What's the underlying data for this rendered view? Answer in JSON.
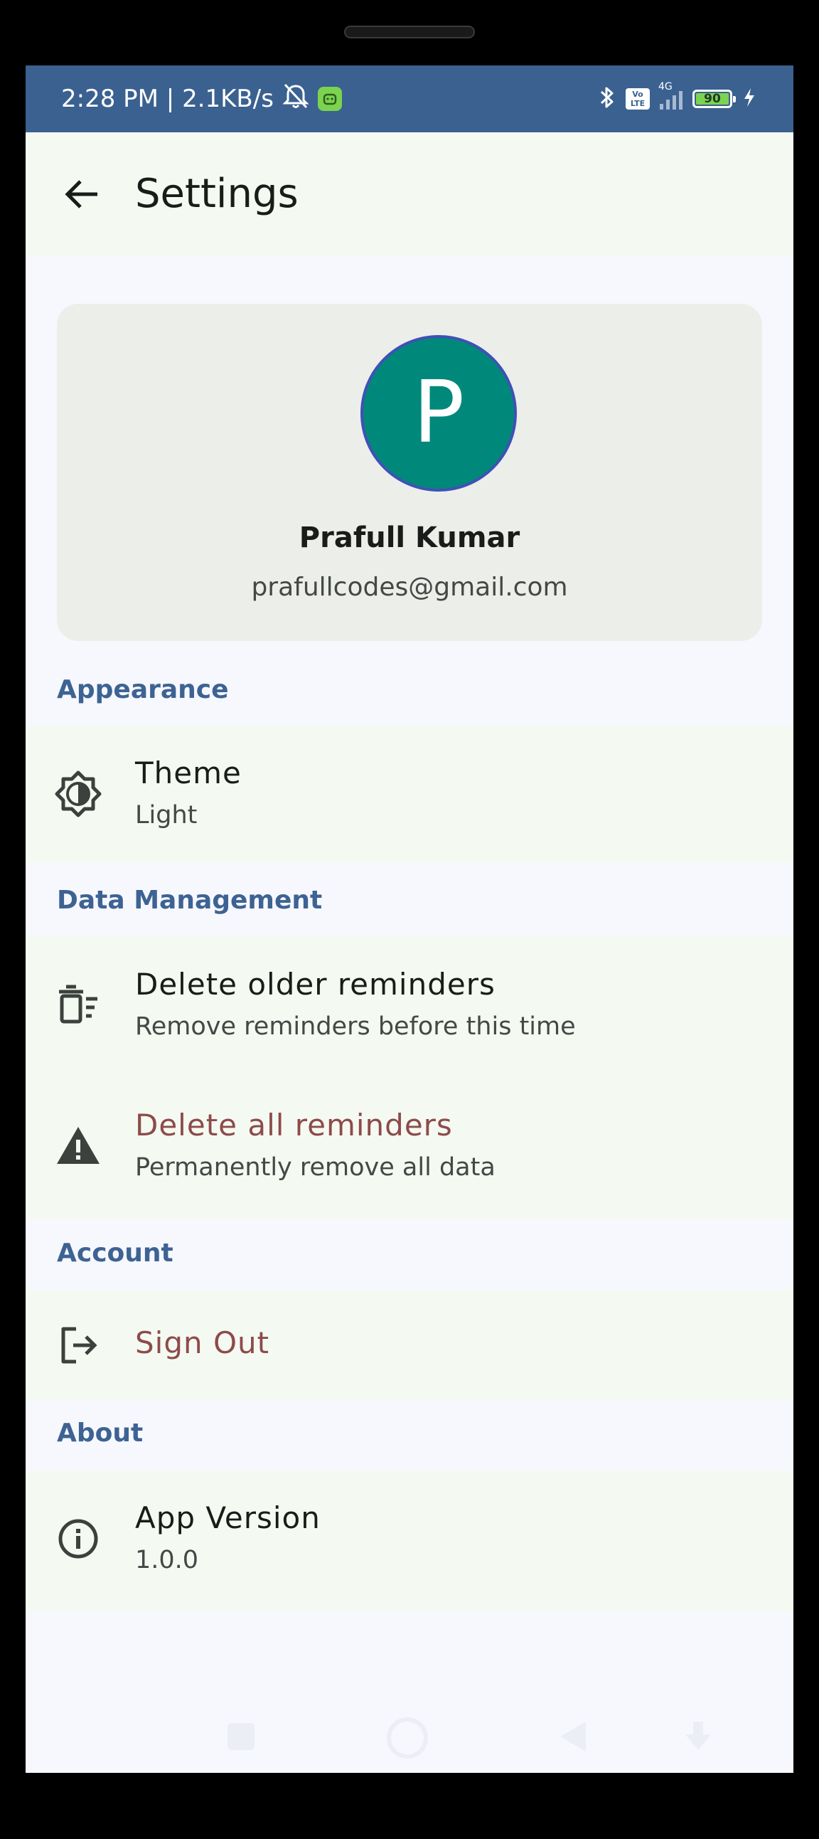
{
  "status_bar": {
    "time_speed": "2:28 PM | 2.1KB/s",
    "lte_label": "Vo\nLTE",
    "network": "4G",
    "battery": "90"
  },
  "app_bar": {
    "title": "Settings",
    "back_icon": "arrow-left-icon"
  },
  "profile": {
    "initial": "P",
    "name": "Prafull Kumar",
    "email": "prafullcodes@gmail.com",
    "avatar_color": "#00897b"
  },
  "sections": {
    "appearance": {
      "header": "Appearance",
      "theme": {
        "title": "Theme",
        "subtitle": "Light",
        "icon": "brightness-icon"
      }
    },
    "data_management": {
      "header": "Data Management",
      "delete_older": {
        "title": "Delete older reminders",
        "subtitle": "Remove reminders before this time",
        "icon": "delete-sweep-icon"
      },
      "delete_all": {
        "title": "Delete all reminders",
        "subtitle": "Permanently remove all data",
        "icon": "warning-icon"
      }
    },
    "account": {
      "header": "Account",
      "sign_out": {
        "title": "Sign Out",
        "icon": "logout-icon"
      }
    },
    "about": {
      "header": "About",
      "app_version": {
        "title": "App Version",
        "subtitle": "1.0.0",
        "icon": "info-icon"
      }
    }
  },
  "colors": {
    "status_bar": "#3a6190",
    "section_header": "#3d6393",
    "danger_text": "#8e4a4a",
    "row_background": "#f4faf1",
    "page_background": "#f7f8fe"
  }
}
